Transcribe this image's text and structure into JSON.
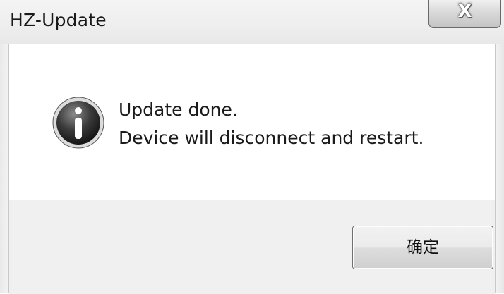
{
  "window": {
    "title": "HZ-Update",
    "close_glyph": "X"
  },
  "message": {
    "icon": "info-icon",
    "line1": "Update done.",
    "line2": "Device will disconnect and restart."
  },
  "buttons": {
    "ok_label": "确定"
  }
}
